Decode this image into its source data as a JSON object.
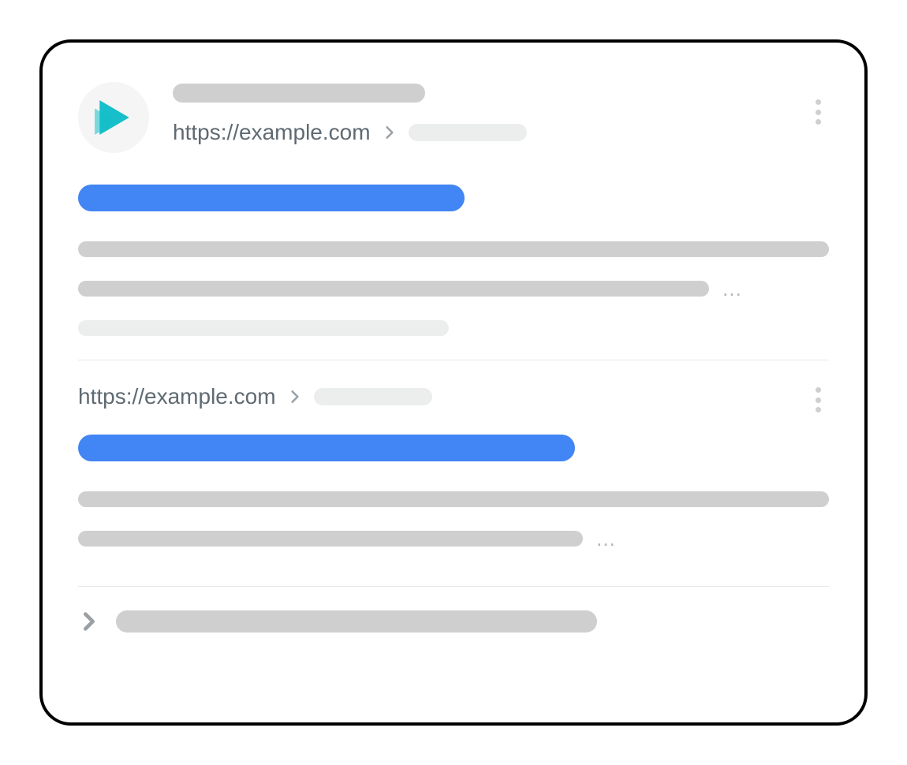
{
  "results": [
    {
      "favicon": "teal-triangle-icon",
      "url": "https://example.com"
    },
    {
      "url": "https://example.com"
    }
  ],
  "colors": {
    "link_blue": "#4285f4",
    "placeholder_grey": "#cfcfcf",
    "placeholder_light": "#eceded",
    "text_grey": "#5f6a72"
  }
}
